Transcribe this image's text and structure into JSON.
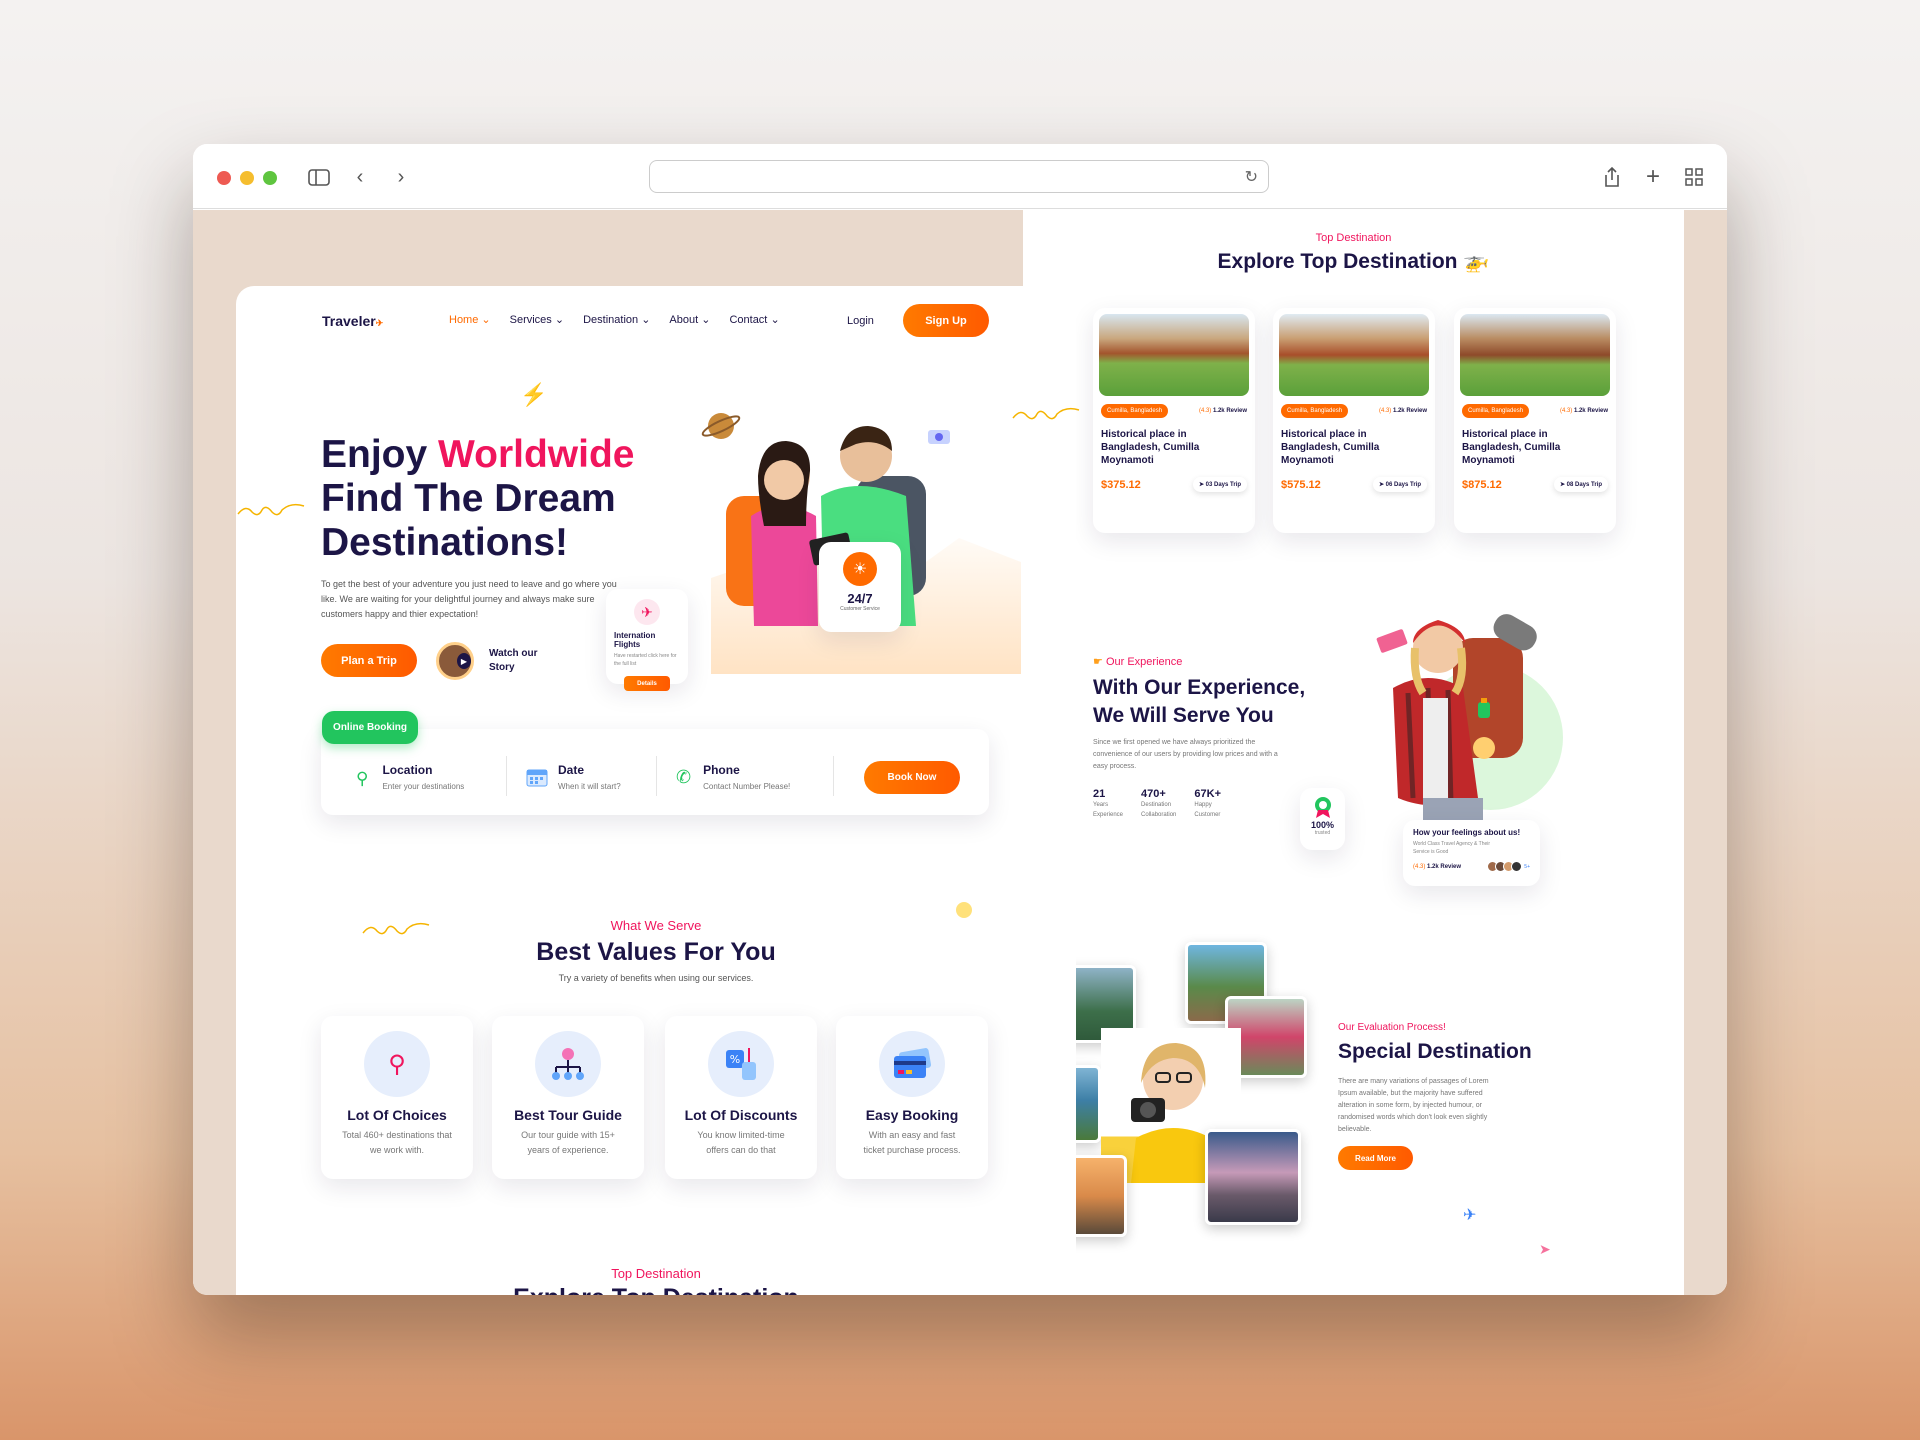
{
  "nav": {
    "logo": "Traveler",
    "items": [
      {
        "label": "Home",
        "active": true
      },
      {
        "label": "Services"
      },
      {
        "label": "Destination"
      },
      {
        "label": "About"
      },
      {
        "label": "Contact"
      }
    ],
    "login": "Login",
    "signup": "Sign Up"
  },
  "hero": {
    "title_part1": "Enjoy ",
    "title_highlight": "Worldwide",
    "title_line2": "Find The Dream",
    "title_line3": "Destinations!",
    "description": "To get the best of your adventure you just need to leave and go where you like. We are waiting for your delightful journey and always make sure customers happy and thier expectation!",
    "plan_button": "Plan a Trip",
    "watch_line1": "Watch our",
    "watch_line2": "Story",
    "flight_card": {
      "title": "Internation Flights",
      "text": "Have restarted click here for the full list",
      "button": "Details"
    },
    "service_card": {
      "value": "24/7",
      "label": "Customer Service"
    }
  },
  "booking": {
    "tag": "Online Booking",
    "fields": [
      {
        "label": "Location",
        "hint": "Enter your destinations"
      },
      {
        "label": "Date",
        "hint": "When it will start?"
      },
      {
        "label": "Phone",
        "hint": "Contact Number Please!"
      }
    ],
    "button": "Book Now"
  },
  "serve": {
    "eyebrow": "What We Serve",
    "title": "Best Values For You",
    "subtitle": "Try a variety of benefits when using our services.",
    "cards": [
      {
        "title": "Lot Of Choices",
        "text": "Total 460+ destinations that we work with."
      },
      {
        "title": "Best Tour Guide",
        "text": "Our tour guide with 15+ years of experience."
      },
      {
        "title": "Lot Of Discounts",
        "text": "You know limited-time offers can do that"
      },
      {
        "title": "Easy Booking",
        "text": "With an easy and fast ticket purchase process."
      }
    ]
  },
  "bottom_left": {
    "eyebrow": "Top Destination",
    "title": "Explore Top Destination"
  },
  "top_dest": {
    "eyebrow": "Top Destination",
    "title": "Explore Top Destination",
    "cards": [
      {
        "tag": "Cumilla, Bangladesh",
        "rating": "(4.3)",
        "reviews": "1.2k Review",
        "title": "Historical place in Bangladesh, Cumilla Moynamoti",
        "price": "$375.12",
        "trip": "03 Days Trip"
      },
      {
        "tag": "Cumilla, Bangladesh",
        "rating": "(4.3)",
        "reviews": "1.2k Review",
        "title": "Historical place in Bangladesh, Cumilla Moynamoti",
        "price": "$575.12",
        "trip": "06 Days Trip"
      },
      {
        "tag": "Cumilla, Bangladesh",
        "rating": "(4.3)",
        "reviews": "1.2k Review",
        "title": "Historical place in Bangladesh, Cumilla Moynamoti",
        "price": "$875.12",
        "trip": "08 Days Trip"
      }
    ]
  },
  "experience": {
    "eyebrow": "Our Experience",
    "title_line1": "With Our Experience,",
    "title_line2": "We Will Serve You",
    "text": "Since we first opened we have always prioritized the convenience of our users by providing low prices and with a easy process.",
    "stats": [
      {
        "value": "21",
        "label1": "Years",
        "label2": "Experience"
      },
      {
        "value": "470+",
        "label1": "Destination",
        "label2": "Collaboration"
      },
      {
        "value": "67K+",
        "label1": "Happy",
        "label2": "Customer"
      }
    ],
    "badge_value": "100%",
    "badge_label": "trusted",
    "feedback": {
      "title": "How your feelings about us!",
      "text": "World Class Travel Agency & Their Service is Good",
      "rating": "(4.3)",
      "reviews": "1.2k Review",
      "more": "5+"
    }
  },
  "special": {
    "eyebrow": "Our Evaluation Process!",
    "title": "Special Destination",
    "text": "There are many variations of passages of Lorem Ipsum available, but the majority have suffered alteration in some form, by injected humour, or randomised words which don't look even slightly believable.",
    "button": "Read More"
  },
  "colors": {
    "accent": "#ff6a00",
    "pink": "#f0155d",
    "navy": "#1c1546",
    "green": "#22c55e"
  }
}
